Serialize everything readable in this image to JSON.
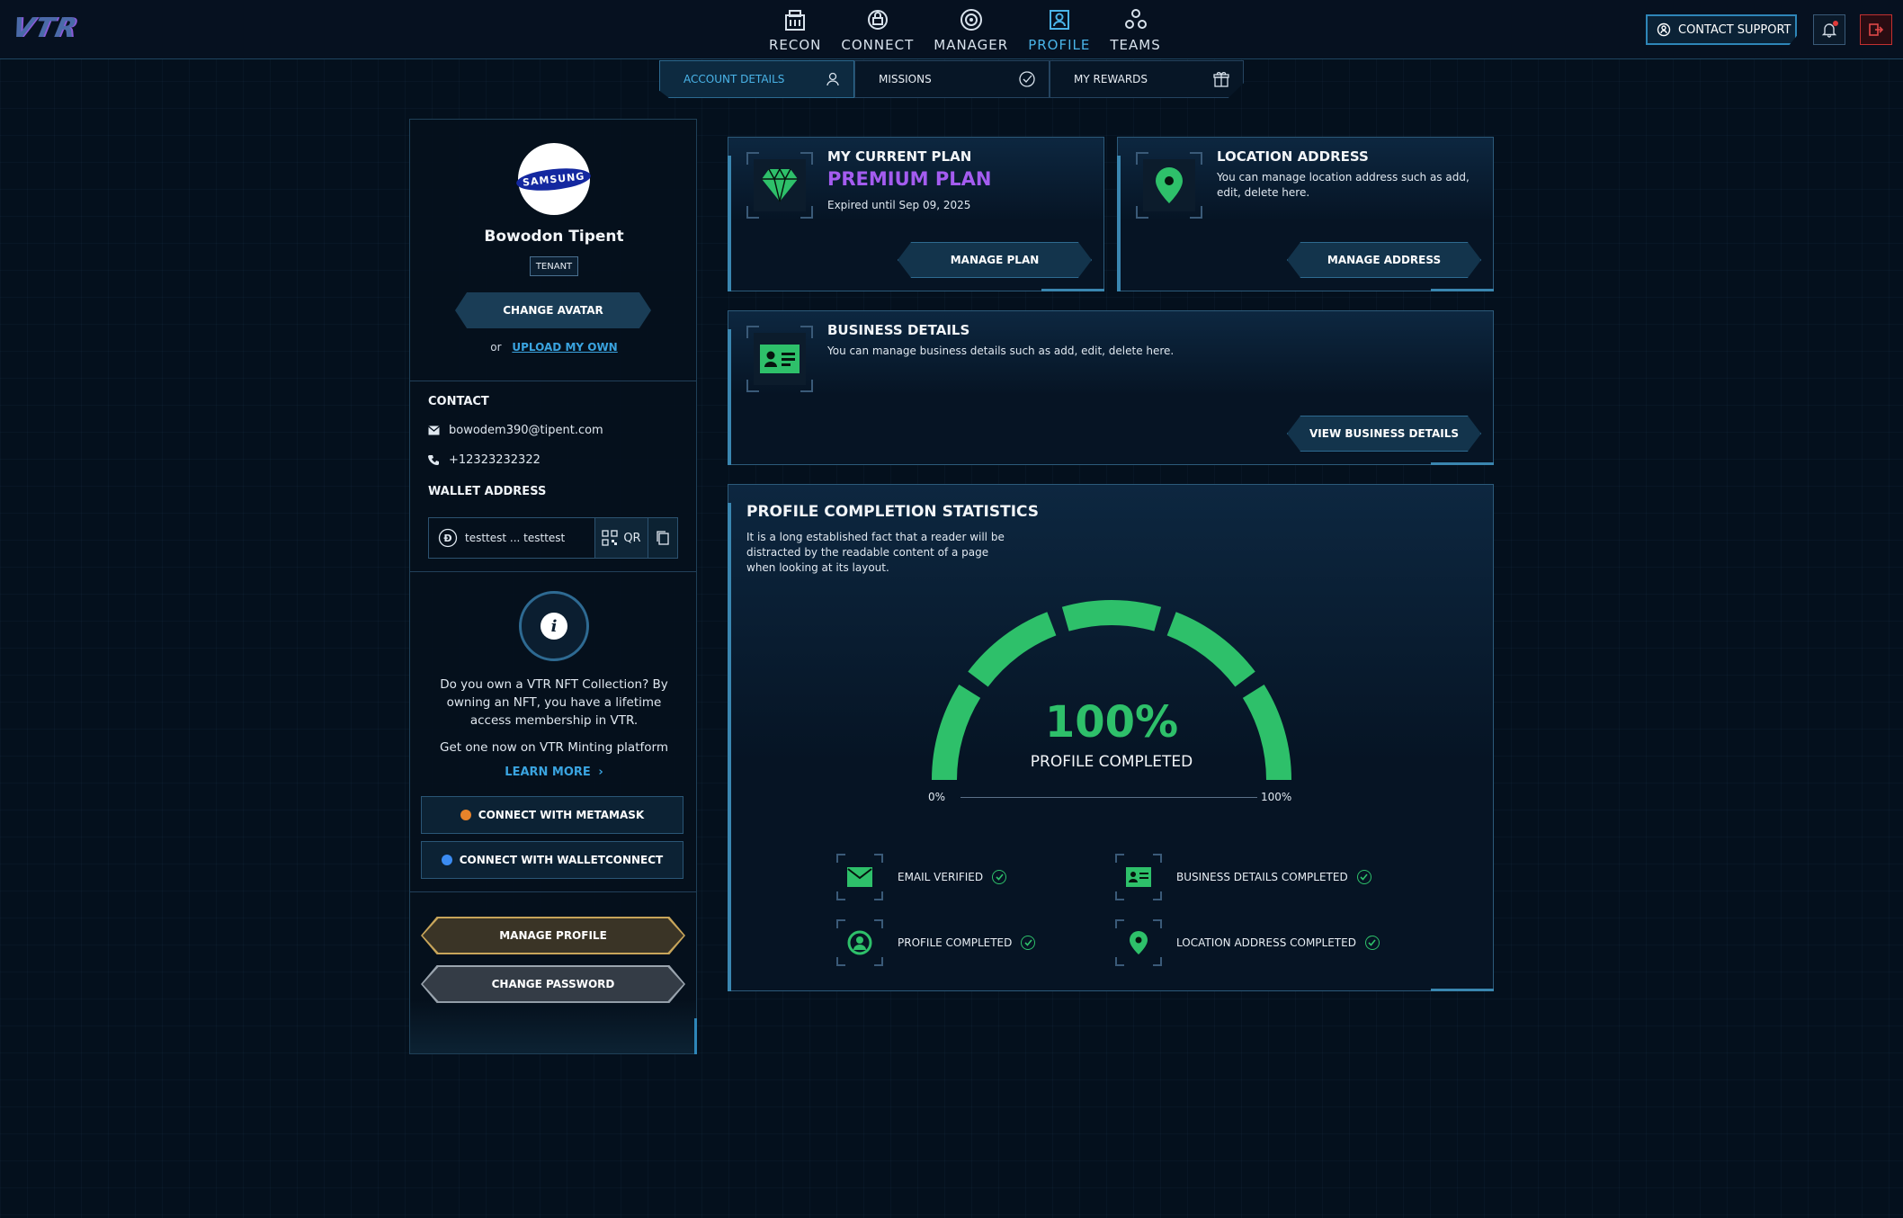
{
  "app": {
    "logo": "VTR"
  },
  "nav": {
    "items": [
      {
        "label": "RECON",
        "icon": "recon-building-icon",
        "active": false
      },
      {
        "label": "CONNECT",
        "icon": "connect-icon",
        "active": false
      },
      {
        "label": "MANAGER",
        "icon": "manager-icon",
        "active": false
      },
      {
        "label": "PROFILE",
        "icon": "profile-icon",
        "active": true
      },
      {
        "label": "TEAMS",
        "icon": "teams-icon",
        "active": false
      }
    ],
    "contact_support": "CONTACT SUPPORT"
  },
  "subtabs": [
    {
      "label": "ACCOUNT DETAILS",
      "icon": "user-icon",
      "active": true
    },
    {
      "label": "MISSIONS",
      "icon": "check-circle-icon",
      "active": false
    },
    {
      "label": "MY REWARDS",
      "icon": "gift-icon",
      "active": false
    }
  ],
  "profile": {
    "avatar_brand": "SAMSUNG",
    "name": "Bowodon Tipent",
    "role": "TENANT",
    "change_avatar": "CHANGE AVATAR",
    "or_text": "or",
    "upload_own": "UPLOAD MY OWN",
    "contact_title": "CONTACT",
    "email": "bowodem390@tipent.com",
    "phone": "+12323232322",
    "wallet_title": "WALLET ADDRESS",
    "wallet_address": "testtest ... testtest",
    "qr_label": "QR",
    "nft_text": "Do you own a VTR NFT Collection? By owning an NFT, you have a lifetime access membership in VTR.",
    "nft_get": "Get one now on VTR Minting platform",
    "learn_more": "LEARN MORE",
    "metamask": "CONNECT WITH METAMASK",
    "walletconnect": "CONNECT WITH WALLETCONNECT",
    "manage_profile": "MANAGE PROFILE",
    "change_password": "CHANGE PASSWORD"
  },
  "plan_card": {
    "title": "MY CURRENT PLAN",
    "plan": "PREMIUM PLAN",
    "expiry": "Expired until Sep 09, 2025",
    "button": "MANAGE PLAN"
  },
  "location_card": {
    "title": "LOCATION ADDRESS",
    "desc": "You can manage location address such as add, edit, delete here.",
    "button": "MANAGE ADDRESS"
  },
  "business_card": {
    "title": "BUSINESS DETAILS",
    "desc": "You can manage business details such as add, edit, delete here.",
    "button": "VIEW BUSINESS DETAILS"
  },
  "stats": {
    "title": "PROFILE COMPLETION STATISTICS",
    "desc": "It is a long established fact that a reader will be distracted by the readable content of a page when looking at its layout.",
    "percent_text": "100%",
    "percent_value": 100,
    "gauge_label": "PROFILE COMPLETED",
    "min_label": "0%",
    "max_label": "100%",
    "items": [
      {
        "label": "EMAIL VERIFIED",
        "icon": "email-icon",
        "done": true
      },
      {
        "label": "BUSINESS DETAILS COMPLETED",
        "icon": "business-card-icon",
        "done": true
      },
      {
        "label": "PROFILE COMPLETED",
        "icon": "user-circle-icon",
        "done": true
      },
      {
        "label": "LOCATION ADDRESS COMPLETED",
        "icon": "location-pin-icon",
        "done": true
      }
    ]
  },
  "colors": {
    "accent": "#4ab4e8",
    "success": "#2ec06a",
    "premium": "#a45cf0",
    "danger": "#d03a3a"
  }
}
